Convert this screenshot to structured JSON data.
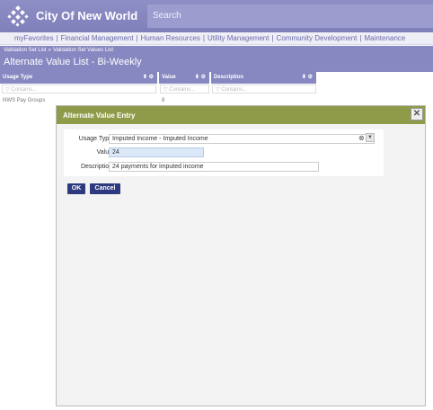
{
  "header": {
    "app_title": "City Of New World",
    "search_placeholder": "Search"
  },
  "nav": {
    "items": [
      "myFavorites",
      "Financial Management",
      "Human Resources",
      "Utility Management",
      "Community Development",
      "Maintenance"
    ],
    "separator": "|"
  },
  "breadcrumb": {
    "items": [
      "Validation Set List",
      "Validation Set Values List"
    ],
    "separator": "»"
  },
  "page": {
    "title": "Alternate Value List - Bi-Weekly"
  },
  "grid": {
    "columns": [
      {
        "label": "Usage Type",
        "filter_placeholder": "Contains..."
      },
      {
        "label": "Value",
        "filter_placeholder": "Contains..."
      },
      {
        "label": "Description",
        "filter_placeholder": "Contains..."
      }
    ],
    "rows": [
      {
        "usage_type": "NWS Pay Groups",
        "value": "8",
        "description": ""
      }
    ]
  },
  "dialog": {
    "title": "Alternate Value Entry",
    "close_glyph": "✕",
    "fields": {
      "usage_type": {
        "label": "Usage Type",
        "value": "Imputed Income - Imputed Income"
      },
      "value": {
        "label": "Value",
        "value": "24"
      },
      "description": {
        "label": "Description",
        "value": "24 payments for imputed income"
      }
    },
    "buttons": {
      "ok": "OK",
      "cancel": "Cancel"
    }
  },
  "colors": {
    "header_bg": "#8787c1",
    "dialog_header_bg": "#8f9b48",
    "button_bg": "#2e3a7e"
  }
}
